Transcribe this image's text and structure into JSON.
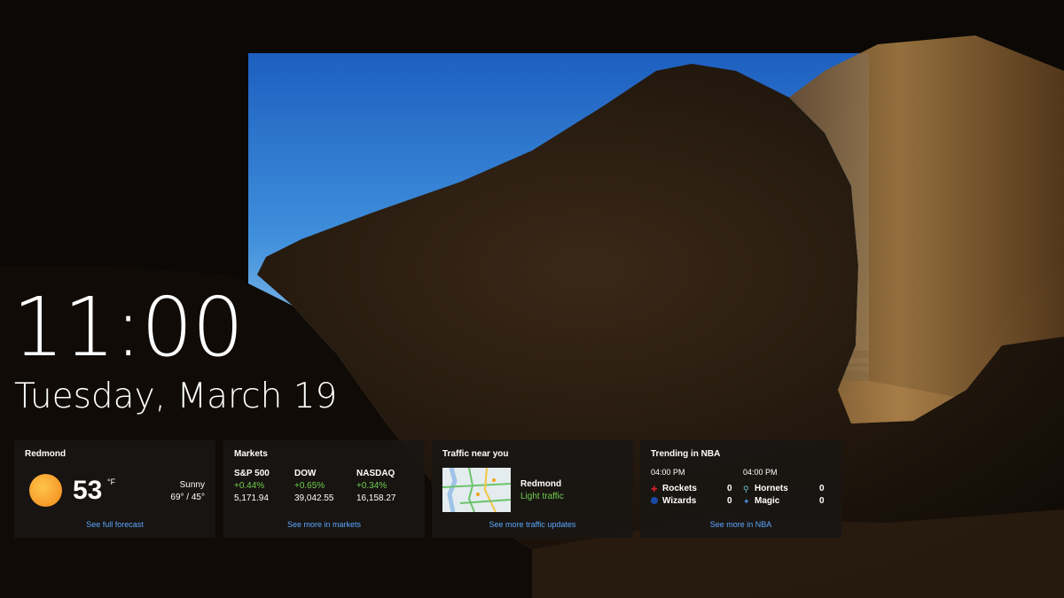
{
  "clock": {
    "time": "11:00",
    "date": "Tuesday, March 19"
  },
  "weather": {
    "title": "Redmond",
    "temperature": "53",
    "unit": "°F",
    "condition": "Sunny",
    "range": "69° / 45°",
    "link": "See full forecast"
  },
  "markets": {
    "title": "Markets",
    "indices": [
      {
        "name": "S&P 500",
        "change": "+0.44%",
        "value": "5,171.94"
      },
      {
        "name": "DOW",
        "change": "+0.65%",
        "value": "39,042.55"
      },
      {
        "name": "NASDAQ",
        "change": "+0.34%",
        "value": "16,158.27"
      }
    ],
    "link": "See more in markets"
  },
  "traffic": {
    "title": "Traffic near you",
    "location": "Redmond",
    "status": "Light traffic",
    "link": "See more traffic updates"
  },
  "nba": {
    "title": "Trending in NBA",
    "games": [
      {
        "time": "04:00 PM",
        "home": "Rockets",
        "home_score": "0",
        "away": "Wizards",
        "away_score": "0"
      },
      {
        "time": "04:00 PM",
        "home": "Hornets",
        "home_score": "0",
        "away": "Magic",
        "away_score": "0"
      }
    ],
    "link": "See more in NBA"
  }
}
